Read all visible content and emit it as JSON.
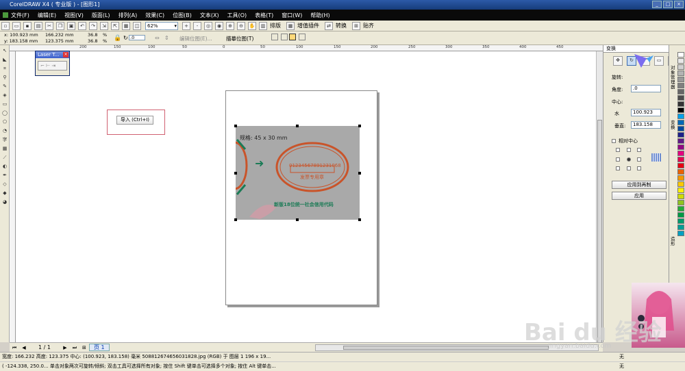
{
  "app": {
    "title": "CorelDRAW X4 ( 专业版 ) - [图形1]"
  },
  "menu": [
    "文件(F)",
    "编辑(E)",
    "视图(V)",
    "版面(L)",
    "排列(A)",
    "效果(C)",
    "位图(B)",
    "文本(X)",
    "工具(O)",
    "表格(T)",
    "窗口(W)",
    "帮助(H)"
  ],
  "toolbar": {
    "zoom": "62%",
    "pai_ban": "排版",
    "zeng_zhi": "增值插件",
    "zhuan_huan": "转换",
    "tie_qi": "贴齐"
  },
  "propbar": {
    "x": "x: 100.923 mm",
    "y": "y: 183.158 mm",
    "w": "166.232 mm",
    "h": "123.375 mm",
    "sx": "36.8",
    "sy": "36.8",
    "pct": "%",
    "angle": ".0",
    "edit_bitmap": "编辑位图(E)...",
    "trace_bitmap": "描摹位图(T)"
  },
  "ruler_h": [
    "200",
    "150",
    "100",
    "50",
    "0",
    "50",
    "100",
    "150",
    "200",
    "250",
    "300",
    "350",
    "400",
    "450"
  ],
  "laser_window": {
    "title": "Laser T..."
  },
  "import_tooltip": "导入 (Ctrl+I)",
  "photo_text": {
    "spec": "规格: 45 x 30 mm",
    "stamp_number": "01234567891231068",
    "stamp_bottom": "发票专用章",
    "caption": "新版18位统一社会信用代码",
    "arrow": "➜"
  },
  "panel": {
    "header": "变换",
    "rotate_label": "旋转:",
    "angle_label": "角度:",
    "angle_value": ".0",
    "center_label": "中心:",
    "h_label": "水",
    "h_value": "100.923",
    "v_label": "垂直:",
    "v_value": "183.158",
    "relative_center": "相对中心",
    "apply_copy": "应用到再制",
    "apply": "应用"
  },
  "palette_labels": [
    "对象管理器",
    "变换",
    "造形"
  ],
  "palette_colors": [
    "#ffffff",
    "#e8e8e8",
    "#cfcfcf",
    "#b3b3b3",
    "#999999",
    "#808080",
    "#666666",
    "#4d4d4d",
    "#333333",
    "#000000",
    "#00a0e9",
    "#0068b7",
    "#00479d",
    "#1d2088",
    "#601986",
    "#920783",
    "#e4007f",
    "#e5004f",
    "#e60012",
    "#eb6100",
    "#f39800",
    "#fcc800",
    "#fff100",
    "#cfdb00",
    "#8fc31f",
    "#22ac38",
    "#009944",
    "#009b6b",
    "#009e96",
    "#00a0c1"
  ],
  "bottom": {
    "page_info": "1 / 1",
    "page_tab": "页 1"
  },
  "status": {
    "line1": "宽度: 166.232  高度: 123.375  中心: (100.923, 183.158)  毫米        508812674656031828.jpg (RGB) 于 图层 1 196 x 19...",
    "line2": "( -124.338, 250.0... 单击对象两次可旋转/倾斜; 双击工具可选择所有对象; 按住 Shift 键单击可选择多个对象; 按住 Alt 键单击...",
    "fill1": "无",
    "fill2": "无"
  },
  "watermark": {
    "brand": "Bai du 经验",
    "url": "jingyan.baidu.com"
  }
}
